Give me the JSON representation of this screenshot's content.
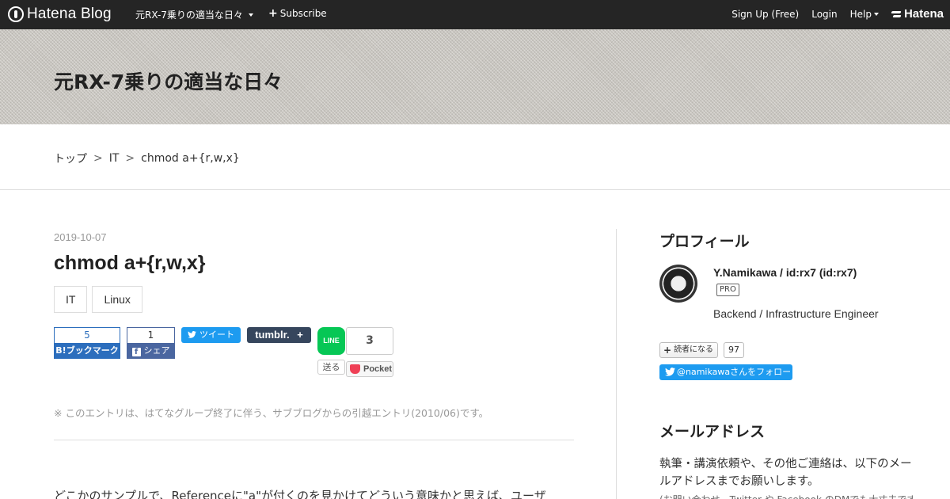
{
  "topbar": {
    "logo_text": "Hatena Blog",
    "blog_menu": "元RX-7乗りの適当な日々",
    "subscribe": "Subscribe",
    "signup": "Sign Up (Free)",
    "login": "Login",
    "help": "Help",
    "brand": "Hatena"
  },
  "header": {
    "blog_title": "元RX-7乗りの適当な日々"
  },
  "breadcrumb": {
    "items": [
      "トップ",
      "IT",
      "chmod a+{r,w,x}"
    ],
    "separator": ">"
  },
  "entry": {
    "date": "2019-10-07",
    "title": "chmod a+{r,w,x}",
    "categories": [
      "IT",
      "Linux"
    ],
    "notice": "※ このエントリは、はてなグループ終了に伴う、サブブログからの引越エントリ(2010/06)です。",
    "body_first_line": "どこかのサンプルで、Referenceに\"a\"が付くのを見かけてどういう意味かと思えば、ユーザ"
  },
  "share": {
    "hatena_count": "5",
    "hatena_label": "B!ブックマーク",
    "facebook_count": "1",
    "facebook_label": "シェア",
    "twitter_label": "ツイート",
    "tumblr_label": "tumblr.",
    "line_label": "LINE",
    "line_send": "送る",
    "pocket_count": "3",
    "pocket_label": "Pocket"
  },
  "sidebar": {
    "profile_title": "プロフィール",
    "profile_name": "Y.Namikawa / id:rx7 (id:rx7)",
    "pro_badge": "PRO",
    "profile_desc": "Backend / Infrastructure Engineer",
    "reader_label": "読者になる",
    "reader_count": "97",
    "follow_label": "@namikawaさんをフォロー",
    "mail_title": "メールアドレス",
    "mail_text": "執筆・講演依頼や、その他ご連絡は、以下のメールアドレスまでお願いします。",
    "mail_text2": "(お問い合わせ、Twitter や Facebook のDMでも大丈夫です)"
  },
  "colors": {
    "topbar_bg": "#252525",
    "hatena_blue": "#2c6ebd",
    "twitter": "#1d9bf0",
    "line": "#06c755"
  }
}
